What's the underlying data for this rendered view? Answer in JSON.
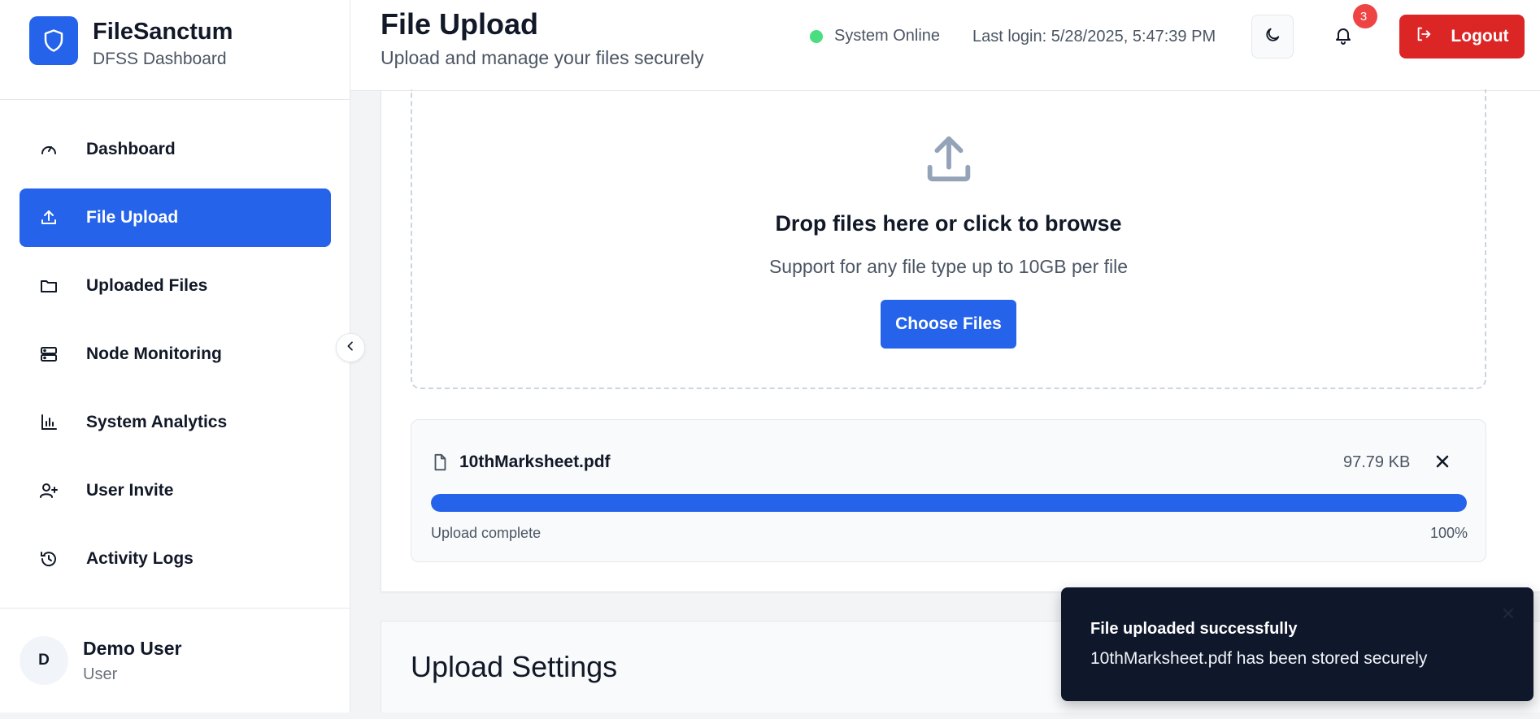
{
  "brand": {
    "name": "FileSanctum",
    "subtitle": "DFSS Dashboard",
    "logo_icon": "shield-icon",
    "color": "#2563eb"
  },
  "sidebar": {
    "items": [
      {
        "label": "Dashboard",
        "icon": "gauge-icon",
        "active": false
      },
      {
        "label": "File Upload",
        "icon": "upload-icon",
        "active": true
      },
      {
        "label": "Uploaded Files",
        "icon": "folder-icon",
        "active": false
      },
      {
        "label": "Node Monitoring",
        "icon": "server-icon",
        "active": false
      },
      {
        "label": "System Analytics",
        "icon": "bar-chart-icon",
        "active": false
      },
      {
        "label": "User Invite",
        "icon": "user-plus-icon",
        "active": false
      },
      {
        "label": "Activity Logs",
        "icon": "history-icon",
        "active": false
      }
    ],
    "user": {
      "initial": "D",
      "name": "Demo User",
      "role": "User"
    }
  },
  "header": {
    "title": "File Upload",
    "subtitle": "Upload and manage your files securely",
    "status": "System Online",
    "last_login": "Last login: 5/28/2025, 5:47:39 PM",
    "notification_count": "3",
    "logout_label": "Logout"
  },
  "dropzone": {
    "title": "Drop files here or click to browse",
    "subtitle": "Support for any file type up to 10GB per file",
    "button_label": "Choose Files"
  },
  "upload": {
    "file_name": "10thMarksheet.pdf",
    "file_size": "97.79 KB",
    "status": "Upload complete",
    "percent_label": "100%",
    "progress": 100
  },
  "settings": {
    "title": "Upload Settings"
  },
  "toast": {
    "title": "File uploaded successfully",
    "message": "10thMarksheet.pdf has been stored securely"
  },
  "colors": {
    "accent": "#2563eb",
    "danger": "#dc2626",
    "online": "#4ade80",
    "toast_bg": "#0f172a"
  }
}
